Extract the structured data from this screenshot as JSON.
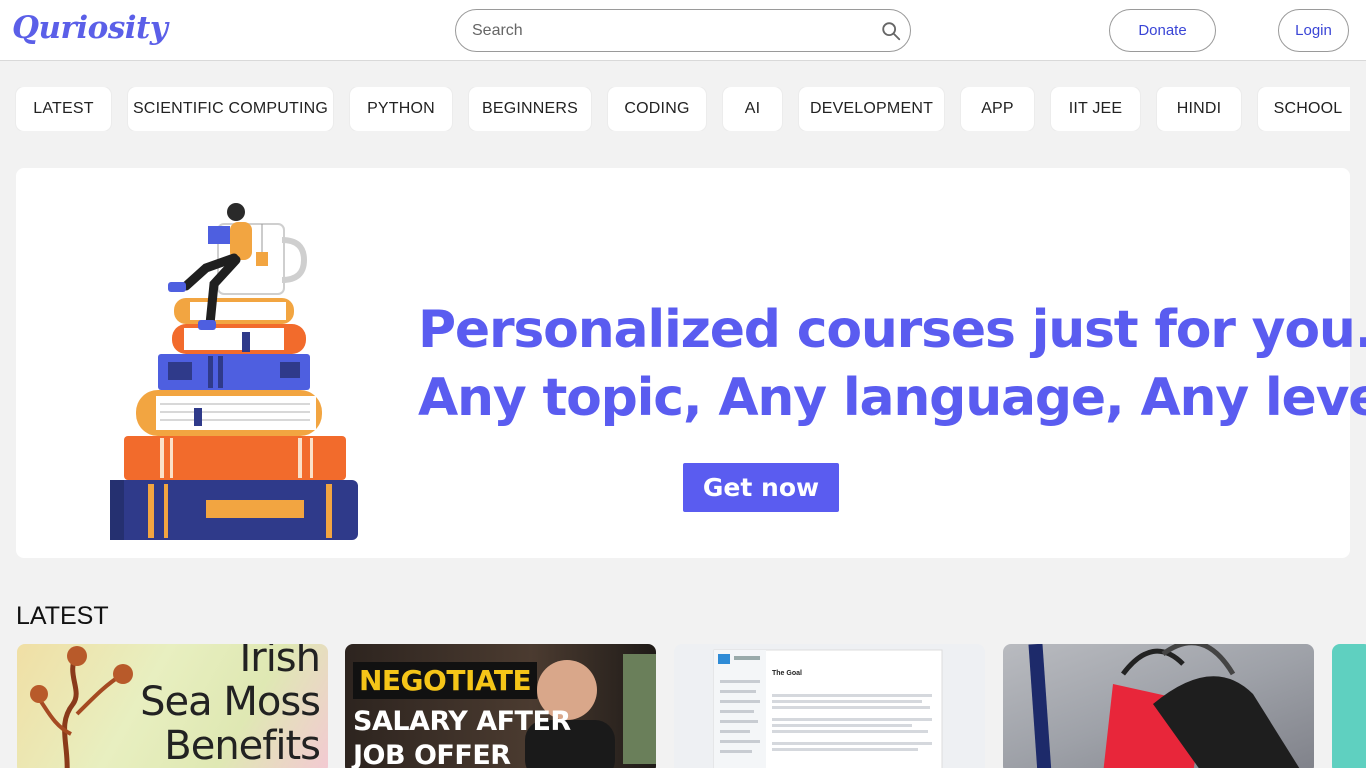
{
  "header": {
    "logo": "Quriosity",
    "search_placeholder": "Search",
    "donate_label": "Donate",
    "login_label": "Login"
  },
  "categories": [
    "LATEST",
    "SCIENTIFIC COMPUTING",
    "PYTHON",
    "BEGINNERS",
    "CODING",
    "AI",
    "DEVELOPMENT",
    "APP",
    "IIT JEE",
    "HINDI",
    "SCHOOL"
  ],
  "banner": {
    "headline_line1": "Personalized courses just for you.",
    "headline_line2": "Any topic, Any language, Any level.",
    "cta_label": "Get now"
  },
  "latest": {
    "title": "LATEST",
    "cards": [
      {
        "lines": [
          "Irish",
          "Sea Moss",
          "Benefits"
        ]
      },
      {
        "tag": "NEGOTIATE",
        "line2": "SALARY AFTER",
        "line3": "JOB OFFER"
      },
      {
        "doc_title": "The Goal"
      },
      {},
      {}
    ]
  },
  "colors": {
    "brand": "#5a5cf0",
    "link": "#3a45d6",
    "background": "#f2f2f2"
  }
}
